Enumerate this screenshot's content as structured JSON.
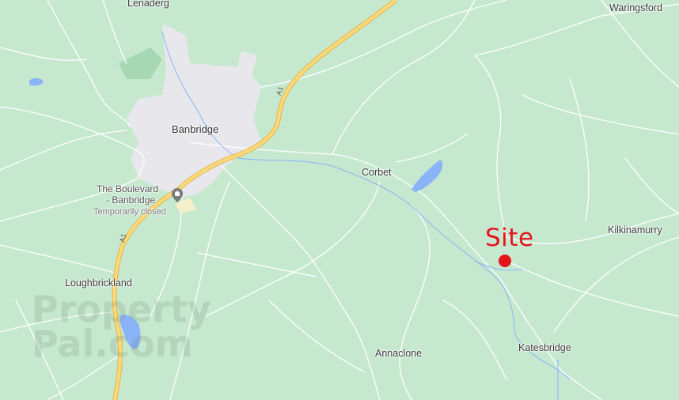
{
  "map": {
    "colors": {
      "land": "#c6e8cf",
      "town": "#e8e8ec",
      "water": "#8ab4f8",
      "motorway": "#f9d97a",
      "motorway_edge": "#e3b64f",
      "minor_road": "#ffffff",
      "site_marker": "#e4161b"
    },
    "places": {
      "lenaderg": "Lenaderg",
      "waringsford": "Waringsford",
      "banbridge": "Banbridge",
      "corbet": "Corbet",
      "kilkinamurry": "Kilkinamurry",
      "loughbrickland": "Loughbrickland",
      "annaclone": "Annaclone",
      "katesbridge": "Katesbridge"
    },
    "poi": {
      "name_line1": "The Boulevard",
      "name_line2": "- Banbridge",
      "status": "Temporarily closed",
      "icon": "shopping-bag-icon"
    },
    "road_labels": {
      "a1_north": "A1",
      "a1_south": "A1"
    },
    "site": {
      "label": "Site",
      "marker_icon": "red-dot-marker"
    },
    "watermark": {
      "line1": "Property",
      "line2": "Pal.com"
    }
  }
}
